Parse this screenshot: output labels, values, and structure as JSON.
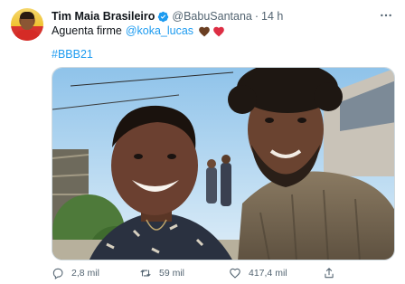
{
  "tweet": {
    "display_name": "Tim Maia Brasileiro",
    "handle": "@BabuSantana",
    "separator": "·",
    "time": "14 h",
    "text_prefix": "Aguenta firme",
    "mention": "@koka_lucas",
    "emojis": [
      "brown-heart-icon",
      "red-heart-icon"
    ],
    "hashtag": "#BBB21",
    "media_alt": "photo"
  },
  "actions": {
    "replies": "2,8 mil",
    "retweets": "59 mil",
    "likes": "417,4 mil"
  },
  "colors": {
    "accent": "#1d9bf0",
    "text_secondary": "#536471",
    "verified": "#1d9bf0"
  }
}
